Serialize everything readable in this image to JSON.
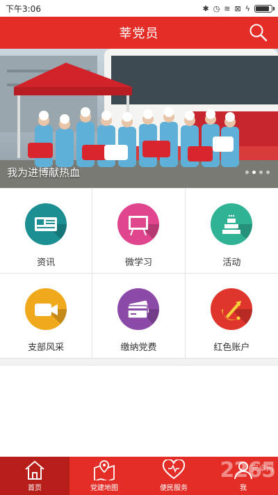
{
  "status": {
    "time": "下午3:06",
    "icons": [
      "bluetooth-icon",
      "alarm-icon",
      "wifi-icon",
      "sim-icon",
      "battery-icon"
    ],
    "battery_level": 0.9
  },
  "header": {
    "title": "莘党员",
    "search_icon": "search-icon"
  },
  "banner": {
    "caption": "我为进博献热血",
    "slide_count": 4,
    "active_slide": 1
  },
  "grid": {
    "items": [
      {
        "label": "资讯",
        "icon": "newspaper-icon",
        "color": "#1b8f92"
      },
      {
        "label": "微学习",
        "icon": "blackboard-icon",
        "color": "#e0468d"
      },
      {
        "label": "活动",
        "icon": "cake-icon",
        "color": "#2fb394"
      },
      {
        "label": "支部风采",
        "icon": "video-camera-icon",
        "color": "#f0a81c"
      },
      {
        "label": "缴纳党费",
        "icon": "payment-card-icon",
        "color": "#8c4aa8"
      },
      {
        "label": "红色账户",
        "icon": "party-emblem-icon",
        "color": "#e0352c"
      }
    ]
  },
  "tabs": [
    {
      "label": "首页",
      "icon": "home-icon",
      "active": true
    },
    {
      "label": "党建地图",
      "icon": "map-icon",
      "active": false
    },
    {
      "label": "便民服务",
      "icon": "heart-icon",
      "active": false
    },
    {
      "label": "我",
      "icon": "user-icon",
      "active": false
    }
  ],
  "watermark": {
    "text": "2265",
    "sub": "安卓网"
  },
  "colors": {
    "primary": "#e32d26",
    "tab_active": "#b81e19"
  }
}
